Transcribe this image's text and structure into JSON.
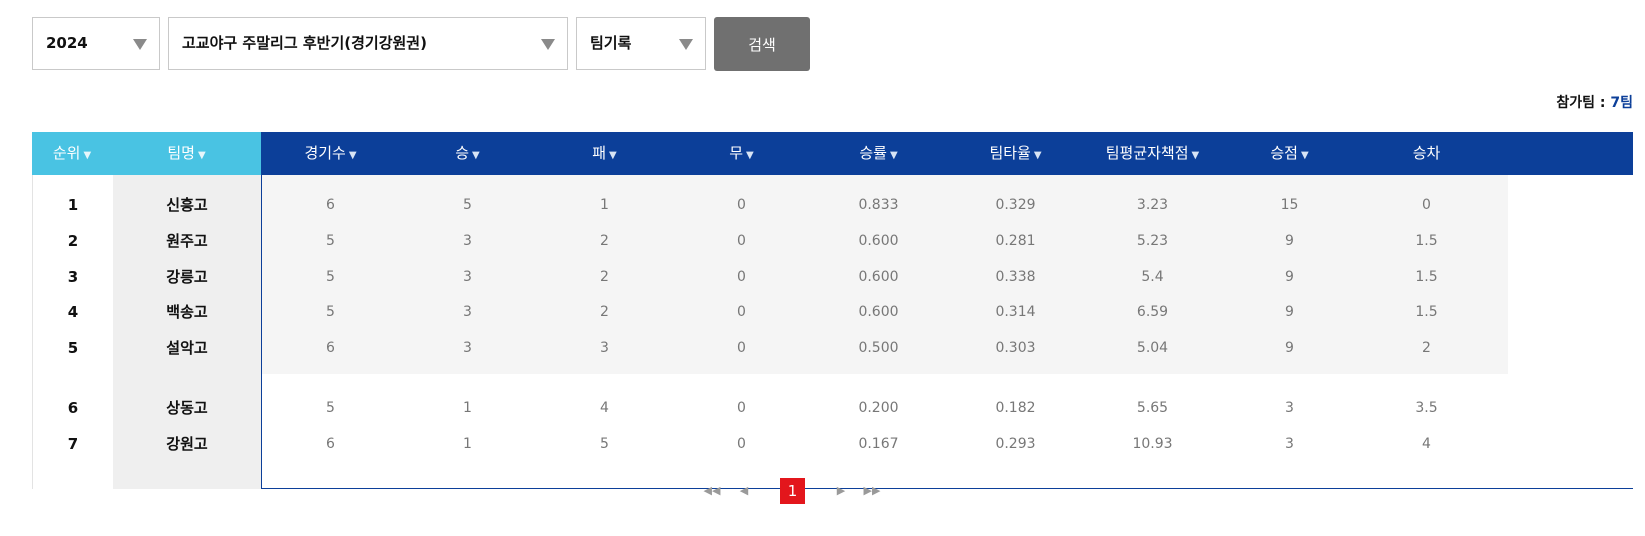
{
  "filters": {
    "year": "2024",
    "league": "고교야구 주말리그 후반기(경기강원권)",
    "record_type": "팀기록",
    "search_label": "검색"
  },
  "team_count": {
    "label": "참가팀 : ",
    "value": "7팀"
  },
  "columns": {
    "rank": "순위",
    "team": "팀명",
    "games": "경기수",
    "wins": "승",
    "losses": "패",
    "draws": "무",
    "win_pct": "승률",
    "batting_avg": "팀타율",
    "era": "팀평균자책점",
    "points": "승점",
    "games_behind": "승차"
  },
  "rows": [
    {
      "rank": "1",
      "team": "신흥고",
      "games": "6",
      "wins": "5",
      "losses": "1",
      "draws": "0",
      "win_pct": "0.833",
      "batting_avg": "0.329",
      "era": "3.23",
      "points": "15",
      "games_behind": "0"
    },
    {
      "rank": "2",
      "team": "원주고",
      "games": "5",
      "wins": "3",
      "losses": "2",
      "draws": "0",
      "win_pct": "0.600",
      "batting_avg": "0.281",
      "era": "5.23",
      "points": "9",
      "games_behind": "1.5"
    },
    {
      "rank": "3",
      "team": "강릉고",
      "games": "5",
      "wins": "3",
      "losses": "2",
      "draws": "0",
      "win_pct": "0.600",
      "batting_avg": "0.338",
      "era": "5.4",
      "points": "9",
      "games_behind": "1.5"
    },
    {
      "rank": "4",
      "team": "백송고",
      "games": "5",
      "wins": "3",
      "losses": "2",
      "draws": "0",
      "win_pct": "0.600",
      "batting_avg": "0.314",
      "era": "6.59",
      "points": "9",
      "games_behind": "1.5"
    },
    {
      "rank": "5",
      "team": "설악고",
      "games": "6",
      "wins": "3",
      "losses": "3",
      "draws": "0",
      "win_pct": "0.500",
      "batting_avg": "0.303",
      "era": "5.04",
      "points": "9",
      "games_behind": "2"
    },
    {
      "rank": "6",
      "team": "상동고",
      "games": "5",
      "wins": "1",
      "losses": "4",
      "draws": "0",
      "win_pct": "0.200",
      "batting_avg": "0.182",
      "era": "5.65",
      "points": "3",
      "games_behind": "3.5"
    },
    {
      "rank": "7",
      "team": "강원고",
      "games": "6",
      "wins": "1",
      "losses": "5",
      "draws": "0",
      "win_pct": "0.167",
      "batting_avg": "0.293",
      "era": "10.93",
      "points": "3",
      "games_behind": "4"
    }
  ],
  "pagination": {
    "current": "1",
    "first_icon": "double-left-icon",
    "prev_icon": "left-icon",
    "next_icon": "right-icon",
    "last_icon": "double-right-icon"
  },
  "colors": {
    "header_light": "#49c3e3",
    "header_dark": "#0c3f99",
    "current_page": "#e3161c",
    "search_button": "#707070"
  }
}
